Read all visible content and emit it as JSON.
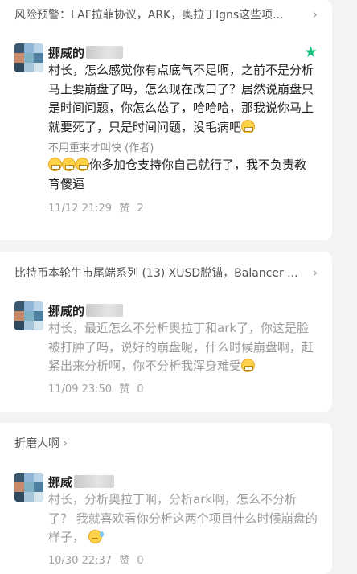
{
  "cards": [
    {
      "title": "风险预警：LAF拉菲协议，ARK，奥拉丁lgns这些项...",
      "comment": {
        "author": "挪威的",
        "starred": true,
        "text": "村长，怎么感觉你有点底气不足啊，之前不是分析马上要崩盘了吗，怎么现在改口了？居然说崩盘只是时间问题，你怎么怂了，哈哈哈，那我说你马上就要死了，只是时间问题，没毛病吧",
        "reply_label": "不用重来才叫快 (作者)",
        "reply_text": "你多加仓支持你自己就行了，我不负责教育傻逼",
        "date": "11/12 21:29",
        "likes_label": "赞",
        "likes": "2"
      }
    },
    {
      "title": "比特币本轮牛市尾端系列 (13) XUSD脱锚，Balancer ...",
      "comment": {
        "author": "挪威的",
        "text": "村长，最近怎么不分析奥拉丁和ark了，你这是脸被打肿了吗，说好的崩盘呢，什么时候崩盘啊，赶紧出来分析啊，你不分析我浑身难受",
        "date": "11/09 23:50",
        "likes_label": "赞",
        "likes": "0"
      }
    },
    {
      "title": "折磨人啊",
      "comment": {
        "author": "挪威",
        "text_a": "村长，分析奥拉丁啊，分析ark啊，怎么不分析了？ 我就喜欢看你分析这两个项目什么时候崩盘的样子，",
        "date": "10/30 22:37",
        "likes_label": "赞",
        "likes": "0"
      }
    }
  ],
  "colors": {
    "background": "#f2f3f5",
    "card": "#ffffff",
    "star": "#19c37d",
    "faded_text": "#9b9b9b"
  },
  "icons": [
    "chevron-right-icon",
    "star-icon",
    "grin-emoji-icon",
    "sweat-emoji-icon"
  ]
}
